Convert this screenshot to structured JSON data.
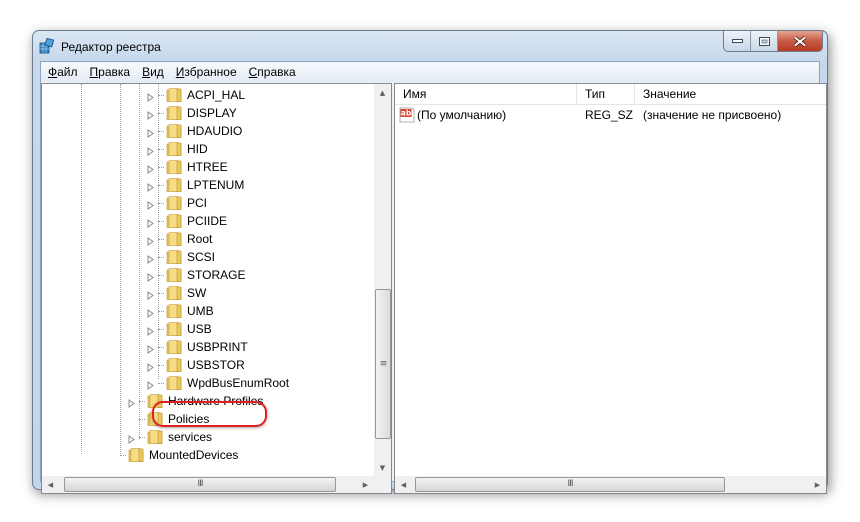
{
  "window": {
    "title": "Редактор реестра",
    "controls": {
      "minimize": "minimize",
      "maximize": "maximize",
      "close": "close"
    }
  },
  "menubar": {
    "items": [
      {
        "label": "Файл",
        "accel": "Ф",
        "rest": "айл"
      },
      {
        "label": "Правка",
        "accel": "П",
        "rest": "равка"
      },
      {
        "label": "Вид",
        "accel": "В",
        "rest": "ид"
      },
      {
        "label": "Избранное",
        "accel": "И",
        "rest": "збранное"
      },
      {
        "label": "Справка",
        "accel": "С",
        "rest": "правка"
      }
    ]
  },
  "tree": {
    "items": [
      {
        "label": "ACPI_HAL",
        "level": 3,
        "expandable": true
      },
      {
        "label": "DISPLAY",
        "level": 3,
        "expandable": true
      },
      {
        "label": "HDAUDIO",
        "level": 3,
        "expandable": true
      },
      {
        "label": "HID",
        "level": 3,
        "expandable": true
      },
      {
        "label": "HTREE",
        "level": 3,
        "expandable": true
      },
      {
        "label": "LPTENUM",
        "level": 3,
        "expandable": true
      },
      {
        "label": "PCI",
        "level": 3,
        "expandable": true
      },
      {
        "label": "PCIIDE",
        "level": 3,
        "expandable": true
      },
      {
        "label": "Root",
        "level": 3,
        "expandable": true
      },
      {
        "label": "SCSI",
        "level": 3,
        "expandable": true
      },
      {
        "label": "STORAGE",
        "level": 3,
        "expandable": true
      },
      {
        "label": "SW",
        "level": 3,
        "expandable": true
      },
      {
        "label": "UMB",
        "level": 3,
        "expandable": true
      },
      {
        "label": "USB",
        "level": 3,
        "expandable": true
      },
      {
        "label": "USBPRINT",
        "level": 3,
        "expandable": true
      },
      {
        "label": "USBSTOR",
        "level": 3,
        "expandable": true,
        "highlighted": true
      },
      {
        "label": "WpdBusEnumRoot",
        "level": 3,
        "expandable": true
      },
      {
        "label": "Hardware Profiles",
        "level": 2,
        "expandable": true
      },
      {
        "label": "Policies",
        "level": 2,
        "expandable": false
      },
      {
        "label": "services",
        "level": 2,
        "expandable": true
      },
      {
        "label": "MountedDevices",
        "level": 1,
        "expandable": false
      }
    ],
    "highlight_color": "#e02020"
  },
  "list": {
    "columns": [
      "Имя",
      "Тип",
      "Значение"
    ],
    "rows": [
      {
        "icon": "string-value-icon",
        "icon_text": "ab",
        "name": "(По умолчанию)",
        "type": "REG_SZ",
        "value": "(значение не присвоено)"
      }
    ]
  },
  "scrollbars": {
    "tree_vertical": {
      "position_fraction": 0.55
    },
    "tree_horizontal": {
      "position_fraction": 0.0
    },
    "list_horizontal": {
      "position_fraction": 0.0
    }
  }
}
